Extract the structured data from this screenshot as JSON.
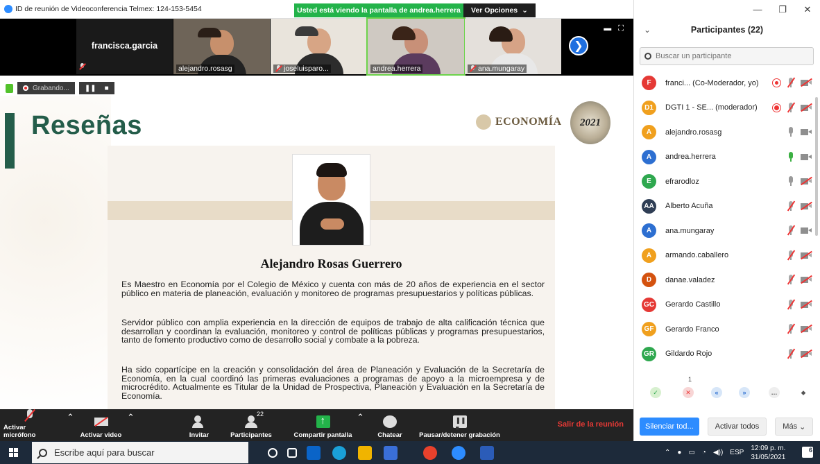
{
  "window": {
    "meeting_title": "ID de reunión de Videoconferencia Telmex: 124-153-5454",
    "share_banner": "Usted está viendo la pantalla de andrea.herrera",
    "view_options": "Ver Opciones",
    "minimize": "—",
    "restore": "❐",
    "close": "✕"
  },
  "video_strip": {
    "tiles": [
      {
        "name": "francisca.garcia",
        "muted": true
      },
      {
        "name": "alejandro.rosasg",
        "muted": false
      },
      {
        "name": "joseluisparo...",
        "muted": true
      },
      {
        "name": "andrea.herrera",
        "muted": false,
        "active": true
      },
      {
        "name": "ana.mungaray",
        "muted": true
      }
    ],
    "next_arrow": "❯"
  },
  "recording": {
    "label": "Grabando...",
    "pause": "❚❚",
    "stop": "■"
  },
  "slide": {
    "title": "Reseñas",
    "brand": "ECONOMÍA",
    "seal_year": "2021",
    "person_name": "Alejandro Rosas Guerrero",
    "paragraphs": [
      "Es Maestro en Economía por el Colegio de México y cuenta con más de 20 años de experiencia en el sector público en materia de planeación, evaluación y monitoreo de programas presupuestarios y políticas públicas.",
      "Servidor público con amplia experiencia en la dirección de equipos de trabajo de alta calificación técnica que desarrollan y coordinan la evaluación, monitoreo y control de políticas públicas y programas presupuestarios, tanto de fomento productivo como de desarrollo social y combate a la pobreza.",
      "Ha sido copartícipe en la creación y consolidación del área de Planeación y Evaluación de la Secretaría de Economía, en la cual coordinó las primeras evaluaciones a programas de apoyo a la microempresa y de microcrédito. Actualmente es Titular de la Unidad de Prospectiva, Planeación y Evaluación en la Secretaría de Economía."
    ]
  },
  "controls": {
    "mic": "Activar micrófono",
    "video": "Activar video",
    "invite": "Invitar",
    "participants": "Participantes",
    "participants_count": "22",
    "share": "Compartir pantalla",
    "chat": "Chatear",
    "record": "Pausar/detener grabación",
    "leave": "Salir de la reunión"
  },
  "participants_panel": {
    "title": "Participantes (22)",
    "search_placeholder": "Buscar un participante",
    "participants": [
      {
        "initials": "F",
        "name": "franci... (Co-Moderador, yo)",
        "color": "#e53935",
        "rec": "ring",
        "mic": "muted",
        "cam": "muted"
      },
      {
        "initials": "D1",
        "name": "DGTI 1 - SE... (moderador)",
        "color": "#f0a01e",
        "rec": "solid",
        "mic": "muted",
        "cam": "muted"
      },
      {
        "initials": "A",
        "name": "alejandro.rosasg",
        "color": "#f0a01e",
        "rec": "",
        "mic": "off",
        "cam": "on"
      },
      {
        "initials": "A",
        "name": "andrea.herrera",
        "color": "#2d6fd1",
        "rec": "",
        "mic": "on",
        "cam": "on"
      },
      {
        "initials": "E",
        "name": "efrarodloz",
        "color": "#2fa84f",
        "rec": "",
        "mic": "off",
        "cam": "muted"
      },
      {
        "initials": "AA",
        "name": "Alberto Acuña",
        "color": "#2f3e55",
        "rec": "",
        "mic": "muted",
        "cam": "muted"
      },
      {
        "initials": "A",
        "name": "ana.mungaray",
        "color": "#2d6fd1",
        "rec": "",
        "mic": "muted",
        "cam": "on"
      },
      {
        "initials": "A",
        "name": "armando.caballero",
        "color": "#f0a01e",
        "rec": "",
        "mic": "muted",
        "cam": "muted"
      },
      {
        "initials": "D",
        "name": "danae.valadez",
        "color": "#d4520f",
        "rec": "",
        "mic": "muted",
        "cam": "muted"
      },
      {
        "initials": "GC",
        "name": "Gerardo  Castillo",
        "color": "#e53935",
        "rec": "",
        "mic": "muted",
        "cam": "muted"
      },
      {
        "initials": "GF",
        "name": "Gerardo Franco",
        "color": "#f0a01e",
        "rec": "",
        "mic": "muted",
        "cam": "muted"
      },
      {
        "initials": "GR",
        "name": "Gildardo Rojo",
        "color": "#2fa84f",
        "rec": "",
        "mic": "muted",
        "cam": "muted"
      }
    ],
    "reaction_count": "1",
    "mute_all": "Silenciar tod...",
    "unmute_all": "Activar todos",
    "more": "Más"
  },
  "taskbar": {
    "search_placeholder": "Escribe aquí para buscar",
    "language": "ESP",
    "time": "12:09 p. m.",
    "date": "31/05/2021",
    "notifications": "6"
  }
}
